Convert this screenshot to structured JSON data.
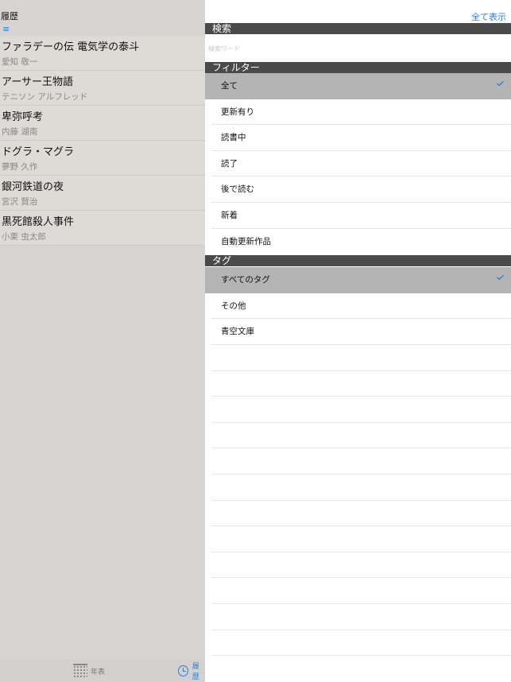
{
  "left_panel": {
    "title": "履歴",
    "menu_icon": "list-icon",
    "books": [
      {
        "title": "ファラデーの伝 電気学の泰斗",
        "author": "愛知 敬一"
      },
      {
        "title": "アーサー王物語",
        "author": "テニソン アルフレッド"
      },
      {
        "title": "卑弥呼考",
        "author": "内藤 湖南"
      },
      {
        "title": "ドグラ・マグラ",
        "author": "夢野 久作"
      },
      {
        "title": "銀河鉄道の夜",
        "author": "宮沢 賢治"
      },
      {
        "title": "黒死館殺人事件",
        "author": "小栗 虫太郎"
      }
    ],
    "tabs": {
      "nenpyo": {
        "label": "年表",
        "icon": "calendar-icon"
      },
      "history": {
        "label": "履歴",
        "icon": "clock-icon"
      }
    }
  },
  "right_panel": {
    "show_all": "全て表示",
    "search": {
      "header": "検索",
      "placeholder": "検索ワード",
      "value": ""
    },
    "filter": {
      "header": "フィルター",
      "items": [
        "全て",
        "更新有り",
        "読書中",
        "読了",
        "後で読む",
        "新着",
        "自動更新作品"
      ],
      "selected": "全て"
    },
    "tags": {
      "header": "タグ",
      "items": [
        "すべてのタグ",
        "その他",
        "青空文庫"
      ],
      "selected": "すべてのタグ"
    }
  },
  "colors": {
    "accent": "#2f7fd7",
    "section_header": "#4a4a4a",
    "selected_row": "#b4b4b4"
  }
}
